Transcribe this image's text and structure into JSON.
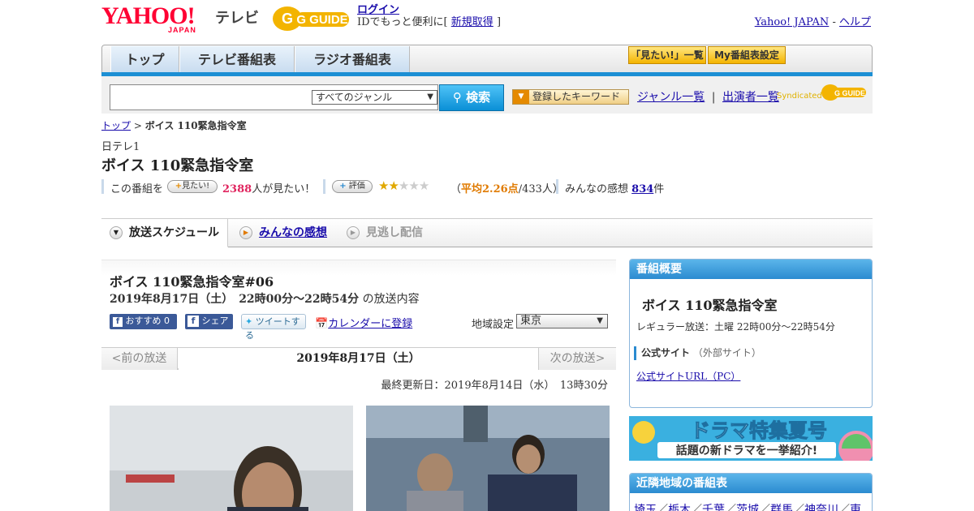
{
  "header": {
    "logo_text": "YAHOO!",
    "logo_sub": "JAPAN",
    "tv_label": "テレビ",
    "gguide_text": "G GUIDE",
    "login": "ログイン",
    "login_note_pre": "IDでもっと便利に[",
    "signup": "新規取得",
    "login_note_post": "]",
    "yahoo_japan_link": "Yahoo! JAPAN",
    "sep": " - ",
    "help_link": "ヘルプ"
  },
  "nav": {
    "tabs": [
      "トップ",
      "テレビ番組表",
      "ラジオ番組表"
    ],
    "mitai_list": "「見たい!」一覧",
    "my_schedule": "My番組表設定"
  },
  "search": {
    "genre": "すべてのジャンル",
    "button": "検索",
    "keyword_button": "登録したキーワード",
    "genre_list": "ジャンル一覧",
    "link_sep": "|",
    "performer_list": "出演者一覧",
    "syndicated": "Syndicated",
    "syndicated_logo": "G GUIDE"
  },
  "breadcrumb": {
    "top": "トップ",
    "sep": " > ",
    "current": "ボイス 110緊急指令室"
  },
  "program": {
    "channel": "日テレ1",
    "title": "ボイス 110緊急指令室",
    "mitai_prefix": "この番組を",
    "mitai_button": "見たい!",
    "mitai_count": "2388",
    "mitai_suffix": "人が見たい！",
    "rating_button": "評価",
    "rating_value": 2,
    "rating_max": 5,
    "avg_prefix": "（",
    "avg_label": "平均2.26点",
    "avg_suffix": "/433人）",
    "impression_prefix": "みんなの感想",
    "impression_count": "834",
    "impression_suffix": "件"
  },
  "content_tabs": [
    "放送スケジュール",
    "みんなの感想",
    "見逃し配信"
  ],
  "episode": {
    "title": "ボイス 110緊急指令室#06",
    "date": "2019年8月17日（土）　22時00分～22時54分",
    "date_suffix": "の放送内容",
    "recommend": "おすすめ 0",
    "share": "シェア",
    "tweet": "ツイートする",
    "calendar": "カレンダーに登録",
    "area_label": "地域設定",
    "area_value": "東京",
    "prev": "<前の放送",
    "current_date": "2019年8月17日（土）",
    "next": "次の放送>",
    "updated": "最終更新日：2019年8月14日（水）　13時30分"
  },
  "summary": {
    "header": "番組概要",
    "title": "ボイス 110緊急指令室",
    "regular": "レギュラー放送：土曜 22時00分～22時54分",
    "official_label": "公式サイト",
    "official_note": "（外部サイト）",
    "official_link": "公式サイトURL（PC）"
  },
  "banner": {
    "line1": "ドラマ特集夏号",
    "line2": "話題の新ドラマを一挙紹介!"
  },
  "neighbors": {
    "header": "近隣地域の番組表",
    "links": [
      "埼玉",
      "栃木",
      "千葉",
      "茨城",
      "群馬",
      "神奈川",
      "東"
    ],
    "sep": "／"
  },
  "colors": {
    "accent": "#1c8fd4",
    "mitai_pink": "#e0245e",
    "avg_orange": "#e07a00"
  }
}
